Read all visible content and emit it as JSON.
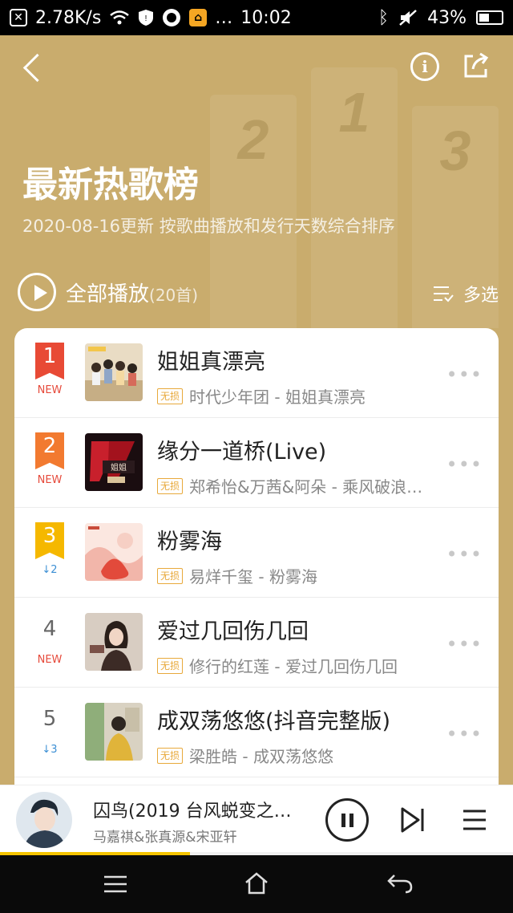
{
  "status_bar": {
    "net_speed": "2.78K/s",
    "time": "10:02",
    "battery": "43%",
    "dots": "…"
  },
  "header": {
    "title": "最新热歌榜",
    "subtitle": "2020-08-16更新 按歌曲播放和发行天数综合排序",
    "podium_numbers": [
      "2",
      "1",
      "3"
    ],
    "play_all_label": "全部播放",
    "play_all_count": "(20首)",
    "multi_select_label": "多选",
    "info_symbol": "i"
  },
  "colors": {
    "header_bg": "#c9ac6d",
    "rank1": "#e84a35",
    "rank2": "#f27a30",
    "rank3": "#f5b800",
    "trend_new": "#e64a3b",
    "trend_down": "#3c8fd4",
    "badge": "#e8a93b",
    "progress": "#f5c400"
  },
  "songs": [
    {
      "rank": "1",
      "trend": "NEW",
      "title": "姐姐真漂亮",
      "badge": "无损",
      "subtitle": "时代少年团 - 姐姐真漂亮",
      "more": "•••"
    },
    {
      "rank": "2",
      "trend": "NEW",
      "title": "缘分一道桥(Live)",
      "badge": "无损",
      "subtitle": "郑希怡&万茜&阿朵 - 乘风破浪…",
      "more": "•••"
    },
    {
      "rank": "3",
      "trend": "↓2",
      "title": "粉雾海",
      "badge": "无损",
      "subtitle": "易烊千玺 - 粉雾海",
      "more": "•••"
    },
    {
      "rank": "4",
      "trend": "NEW",
      "title": "爱过几回伤几回",
      "badge": "无损",
      "subtitle": "修行的红莲 - 爱过几回伤几回",
      "more": "•••"
    },
    {
      "rank": "5",
      "trend": "↓3",
      "title": "成双荡悠悠(抖音完整版)",
      "badge": "无损",
      "subtitle": "梁胜皓 - 成双荡悠悠",
      "more": "•••"
    }
  ],
  "player": {
    "title": "囚鸟(2019 台风蜕变之…",
    "artist": "马嘉祺&张真源&宋亚轩",
    "progress": 0.37
  },
  "icons": [
    "back-icon",
    "info-icon",
    "share-icon",
    "play-circle-icon",
    "multi-select-icon",
    "more-icon",
    "pause-icon",
    "next-icon",
    "queue-icon",
    "menu-icon",
    "home-icon",
    "nav-back-icon"
  ]
}
